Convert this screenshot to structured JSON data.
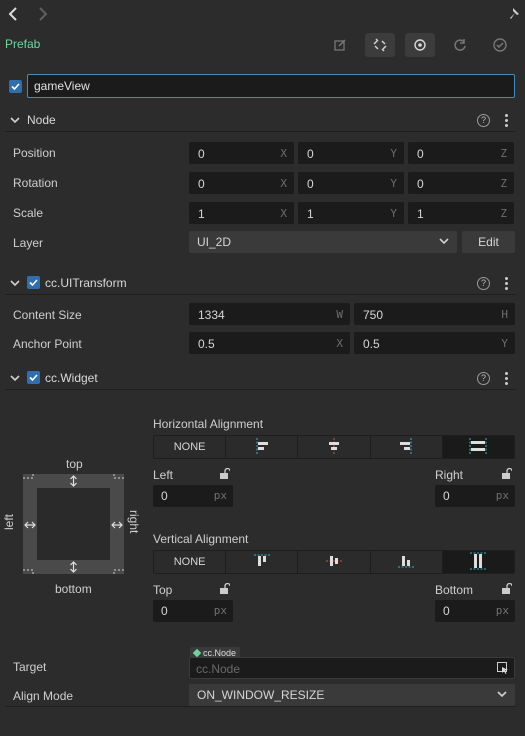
{
  "toolbar": {
    "back_icon": "chevron-left-icon",
    "forward_icon": "chevron-right-icon",
    "pin_icon": "pin-icon",
    "prefab_label": "Prefab",
    "prefab_actions": [
      "edit-icon",
      "unlink-icon",
      "locate-icon",
      "revert-icon",
      "apply-icon"
    ]
  },
  "node": {
    "enabled": true,
    "name": "gameView"
  },
  "node_section": {
    "title": "Node",
    "position": {
      "label": "Position",
      "x": "0",
      "y": "0",
      "z": "0"
    },
    "rotation": {
      "label": "Rotation",
      "x": "0",
      "y": "0",
      "z": "0"
    },
    "scale": {
      "label": "Scale",
      "x": "1",
      "y": "1",
      "z": "1"
    },
    "layer": {
      "label": "Layer",
      "value": "UI_2D",
      "edit_label": "Edit"
    },
    "axis": {
      "x": "X",
      "y": "Y",
      "z": "Z",
      "w": "W",
      "h": "H"
    }
  },
  "ui_transform": {
    "title": "cc.UITransform",
    "enabled": true,
    "content_size": {
      "label": "Content Size",
      "w": "1334",
      "h": "750"
    },
    "anchor_point": {
      "label": "Anchor Point",
      "x": "0.5",
      "y": "0.5"
    }
  },
  "widget": {
    "title": "cc.Widget",
    "enabled": true,
    "diagram": {
      "top": "top",
      "bottom": "bottom",
      "left": "left",
      "right": "right"
    },
    "horizontal": {
      "label": "Horizontal Alignment",
      "none_label": "NONE",
      "options": [
        "align-left-icon",
        "align-h-center-icon",
        "align-right-icon",
        "stretch-horizontal-icon"
      ],
      "active_index": 4,
      "left": {
        "label": "Left",
        "value": "0",
        "unit": "px"
      },
      "right": {
        "label": "Right",
        "value": "0",
        "unit": "px"
      }
    },
    "vertical": {
      "label": "Vertical Alignment",
      "none_label": "NONE",
      "options": [
        "align-top-icon",
        "align-v-center-icon",
        "align-bottom-icon",
        "stretch-vertical-icon"
      ],
      "active_index": 4,
      "top": {
        "label": "Top",
        "value": "0",
        "unit": "px"
      },
      "bottom": {
        "label": "Bottom",
        "value": "0",
        "unit": "px"
      }
    },
    "target": {
      "label": "Target",
      "type_badge": "cc.Node",
      "placeholder": "cc.Node"
    },
    "align_mode": {
      "label": "Align Mode",
      "value": "ON_WINDOW_RESIZE"
    }
  },
  "colors": {
    "accent_green": "#6fd3a0",
    "checkbox_blue": "#2f6fb0",
    "guide_cyan": "#2fb8c8",
    "guide_red": "#d05050"
  }
}
